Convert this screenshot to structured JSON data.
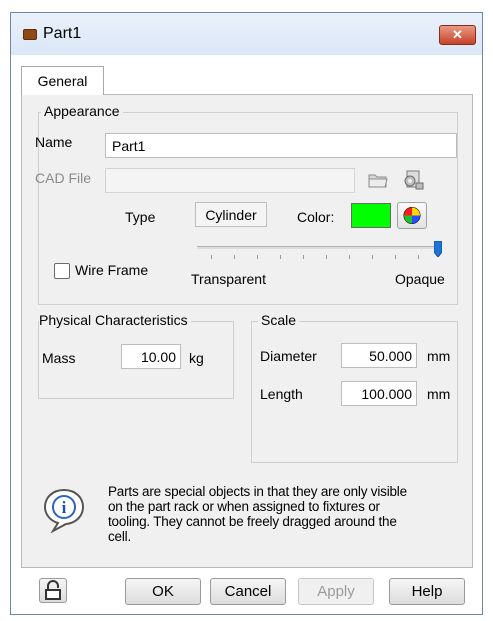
{
  "window": {
    "title": "Part1",
    "close_label": "✕"
  },
  "tabs": [
    {
      "label": "General"
    }
  ],
  "appearance": {
    "group_title": "Appearance",
    "name_label": "Name",
    "name_value": "Part1",
    "cad_file_label": "CAD File",
    "cad_file_value": "",
    "type_label": "Type",
    "type_value": "Cylinder",
    "color_label": "Color:",
    "color_value": "#00ff00",
    "wire_frame_label": "Wire Frame",
    "wire_frame_checked": false,
    "transparency_min_label": "Transparent",
    "transparency_max_label": "Opaque",
    "opacity": 1.0
  },
  "physical": {
    "group_title": "Physical Characteristics",
    "mass_label": "Mass",
    "mass_value": "10.00",
    "mass_unit": "kg"
  },
  "scale": {
    "group_title": "Scale",
    "diameter_label": "Diameter",
    "diameter_value": "50.000",
    "diameter_unit": "mm",
    "length_label": "Length",
    "length_value": "100.000",
    "length_unit": "mm"
  },
  "info": {
    "icon": "info-icon",
    "text": "Parts are special objects in that they are only visible on the part rack or when assigned to fixtures or tooling.  They cannot be freely dragged around the cell."
  },
  "buttons": {
    "ok": "OK",
    "cancel": "Cancel",
    "apply": "Apply",
    "help": "Help"
  }
}
